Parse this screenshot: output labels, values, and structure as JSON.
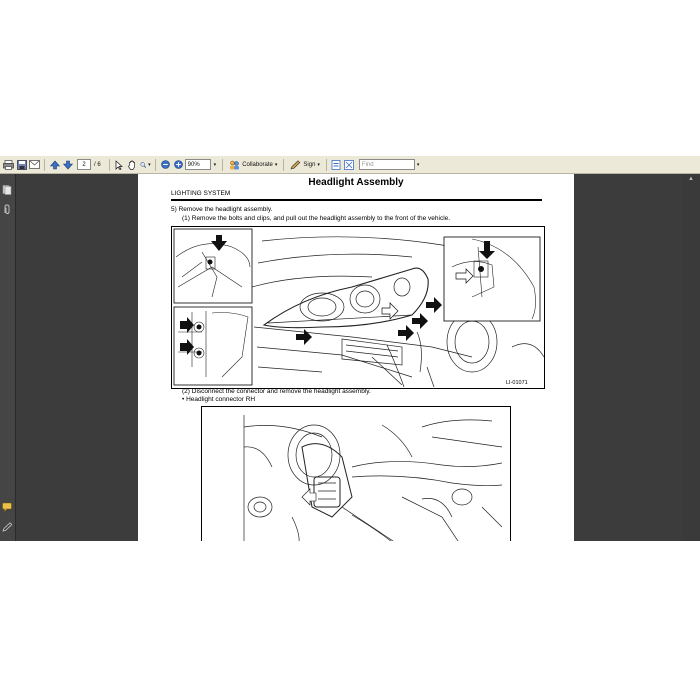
{
  "toolbar": {
    "page_current": "2",
    "page_total": "/ 6",
    "zoom": "90%",
    "collaborate_label": "Collaborate",
    "sign_label": "Sign",
    "find_placeholder": "Find"
  },
  "document": {
    "title": "Headlight Assembly",
    "section": "LIGHTING SYSTEM",
    "step5": "5) Remove the headlight assembly.",
    "step5_1": "(1) Remove the bolts and clips, and pull out the headlight assembly to the front of the vehicle.",
    "figure1_id": "LI-01071",
    "step5_2": "(2) Disconnect the connector and remove the headlight assembly.",
    "bullet": "•  Headlight connector RH"
  },
  "colors": {
    "toolbar_bg": "#ece9d8",
    "workspace_bg": "#3c3c3c",
    "page_bg": "#ffffff"
  }
}
